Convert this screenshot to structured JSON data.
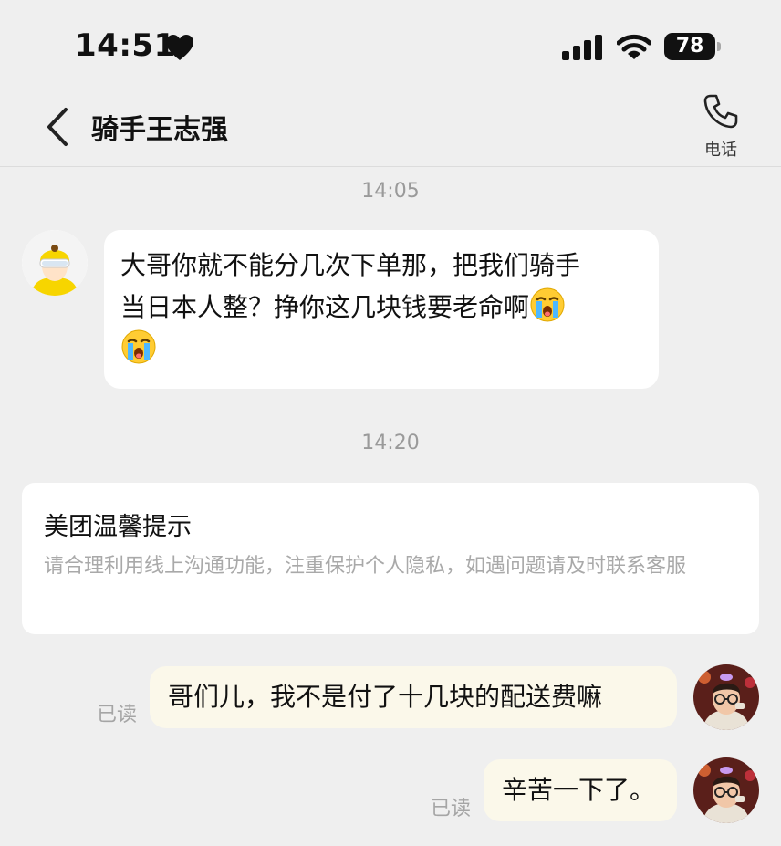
{
  "status_bar": {
    "time": "14:51",
    "battery": "78",
    "icons": [
      "heart-icon",
      "signal-icon",
      "wifi-icon",
      "battery-icon"
    ]
  },
  "header": {
    "title": "骑手王志强",
    "call_label": "电话",
    "icons": [
      "back-chevron-icon",
      "phone-icon"
    ]
  },
  "messages": {
    "ts1": "14:05",
    "rider_line1": "大哥你就不能分几次下单那，把我们骑手",
    "rider_line2": "当日本人整？挣你这几块钱要老命啊",
    "emoji_name": "loudly-crying-face-emoji",
    "ts2": "14:20",
    "notice_title": "美团温馨提示",
    "notice_body": "请合理利用线上沟通功能，注重保护个人隐私，如遇问题请及时联系客服",
    "me1": "哥们儿，我不是付了十几块的配送费嘛",
    "me1_status": "已读",
    "me2": "辛苦一下了。",
    "me2_status": "已读"
  },
  "colors": {
    "background": "#efefef",
    "incoming_bubble": "#ffffff",
    "outgoing_bubble": "#fbf8ea",
    "rider_helmet": "#f7d500"
  }
}
